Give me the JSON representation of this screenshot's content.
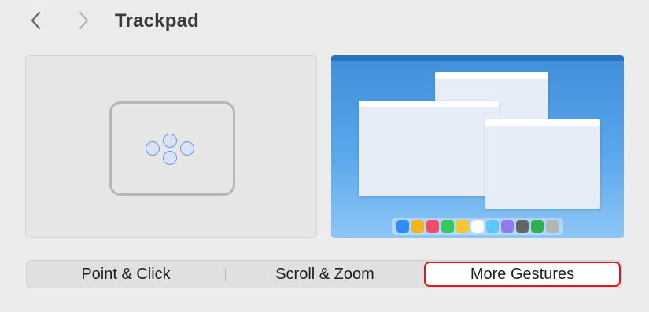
{
  "header": {
    "title": "Trackpad",
    "back_icon": "chevron-left-icon",
    "forward_icon": "chevron-right-icon"
  },
  "preview": {
    "trackpad_icon": "trackpad-four-finger-icon",
    "illustration": "app-expose-illustration",
    "dock_colors": [
      "#2f8cf5",
      "#f6b21a",
      "#ee4c6a",
      "#34c759",
      "#f7c928",
      "#ffffff",
      "#5ac8fa",
      "#8e7cf0",
      "#636366",
      "#30b050",
      "#b5b5b5"
    ]
  },
  "tabs": {
    "point_click": "Point & Click",
    "scroll_zoom": "Scroll & Zoom",
    "more_gestures": "More Gestures",
    "selected": "More Gestures"
  },
  "colors": {
    "highlight": "#e5141a",
    "desktop_blue": "#4a9ae2"
  }
}
